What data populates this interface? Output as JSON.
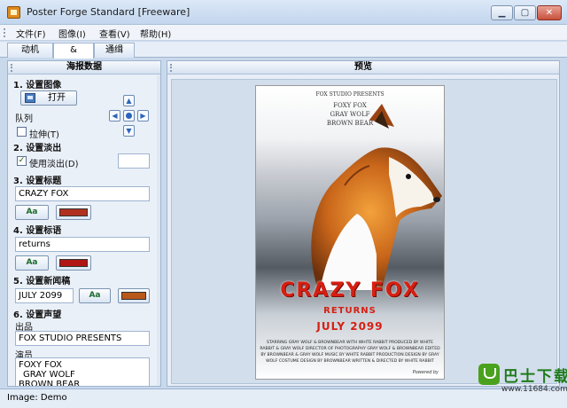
{
  "window": {
    "title": "Poster Forge Standard [Freeware]"
  },
  "menu": [
    "文件(F)",
    "图像(I)",
    "查看(V)",
    "帮助(H)"
  ],
  "tabs": [
    {
      "label": "动机"
    },
    {
      "label": "&"
    },
    {
      "label": "通缉"
    }
  ],
  "left_panel": {
    "header": "海报数据",
    "sections": {
      "s1": "1. 设置图像",
      "s2": "2. 设置淡出",
      "s3": "3. 设置标题",
      "s4": "4. 设置标语",
      "s5": "5. 设置新闻稿",
      "s6": "6. 设置声望"
    },
    "open_button": "打开",
    "align_label": "队列",
    "stretch_label": "拉伸(T)",
    "stretch_checked": false,
    "fade_label": "使用淡出(D)",
    "fade_checked": true,
    "title_value": "CRAZY FOX",
    "tagline_value": "returns",
    "release_value": "JULY 2099",
    "font_button": "Aa",
    "title_color": "#b0311f",
    "tagline_color": "#b01414",
    "release_color": "#b8581a",
    "presents_label": "出品",
    "presents_value": "FOX STUDIO PRESENTS",
    "cast_label": "演员",
    "cast_lines": [
      "FOXY FOX",
      "GRAY WOLF",
      "BROWN BEAR"
    ]
  },
  "right_panel": {
    "header": "预览",
    "poster": {
      "studio": "FOX STUDIO PRESENTS",
      "cast": [
        "FOXY FOX",
        "GRAY WOLF",
        "BROWN BEAR"
      ],
      "title": "CRAZY FOX",
      "tagline": "RETURNS",
      "date": "JULY 2099",
      "credits": "STARRING GRAY WOLF & BROWNBEAR WITH WHITE RABBIT PRODUCED BY WHITE RABBIT & GRAY WOLF DIRECTOR OF PHOTOGRAPHY GRAY WOLF & BROWNBEAR EDITED BY BROWNBEAR & GRAY WOLF MUSIC BY WHITE RABBIT PRODUCTION DESIGN BY GRAY WOLF COSTUME DESIGN BY BROWNBEAR WRITTEN & DIRECTED BY WHITE RABBIT",
      "powered": "Powered by"
    }
  },
  "status": {
    "text": "Image: Demo"
  },
  "watermark": {
    "title": "巴士下载",
    "url": "www.11684.com"
  }
}
